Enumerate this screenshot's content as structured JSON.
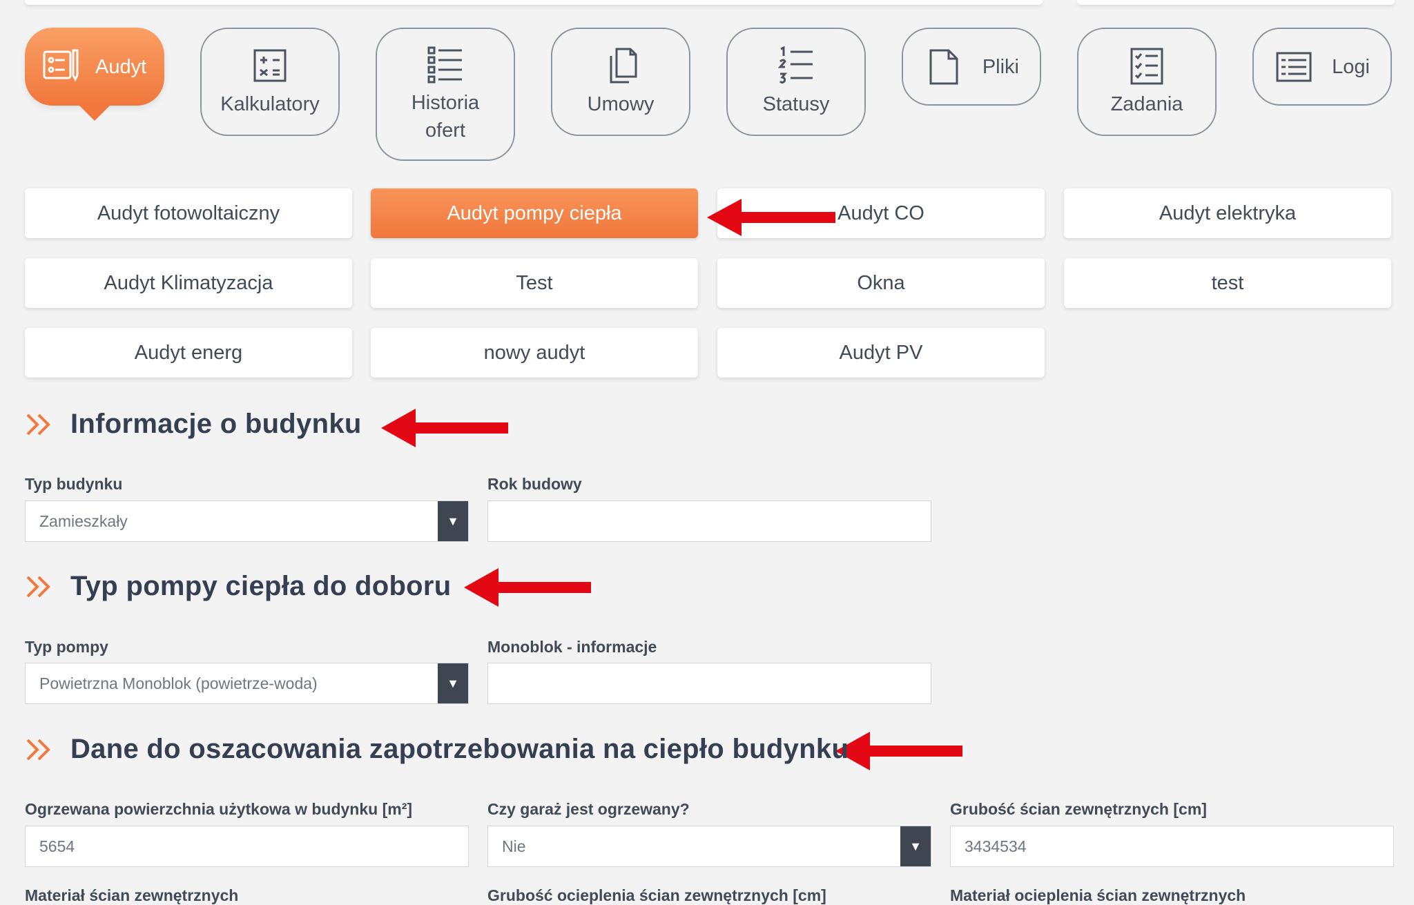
{
  "nav": {
    "tiles": [
      {
        "label": "Audyt",
        "icon": "audit-icon",
        "active": true
      },
      {
        "label": "Kalkulatory",
        "icon": "calculator-icon"
      },
      {
        "label": "Historia\nofert",
        "icon": "list-icon"
      },
      {
        "label": "Umowy",
        "icon": "documents-icon"
      },
      {
        "label": "Statusy",
        "icon": "numbered-list-icon"
      },
      {
        "label": "Pliki",
        "icon": "file-icon"
      },
      {
        "label": "Zadania",
        "icon": "checklist-icon"
      },
      {
        "label": "Logi",
        "icon": "log-icon"
      }
    ]
  },
  "audits": {
    "buttons": [
      "Audyt fotowoltaiczny",
      "Audyt pompy ciepła",
      "Audyt CO",
      "Audyt elektryka",
      "Audyt Klimatyzacja",
      "Test",
      "Okna",
      "test",
      "Audyt energ",
      "nowy audyt",
      "Audyt PV"
    ],
    "active": "Audyt pompy ciepła"
  },
  "sections": {
    "building": {
      "title": "Informacje o budynku",
      "type_label": "Typ budynku",
      "type_value": "Zamieszkały",
      "year_label": "Rok budowy",
      "year_value": ""
    },
    "pump": {
      "title": "Typ pompy ciepła do doboru",
      "type_label": "Typ pompy",
      "type_value": "Powietrzna Monoblok (powietrze-woda)",
      "mono_label": "Monoblok - informacje",
      "mono_value": ""
    },
    "demand": {
      "title": "Dane do oszacowania zapotrzebowania na ciepło budynku",
      "area_label": "Ogrzewana powierzchnia użytkowa w budynku [m²]",
      "area_value": "5654",
      "garage_label": "Czy garaż jest ogrzewany?",
      "garage_value": "Nie",
      "wall_label": "Grubość ścian zewnętrznych [cm]",
      "wall_value": "3434534",
      "next_labels": [
        "Materiał ścian zewnętrznych",
        "Grubość ocieplenia ścian zewnętrznych [cm]",
        "Materiał ocieplenia ścian zewnętrznych"
      ]
    }
  },
  "colors": {
    "accent": "#f1773c",
    "annotation_arrow": "#e30613",
    "heading": "#353f52"
  }
}
